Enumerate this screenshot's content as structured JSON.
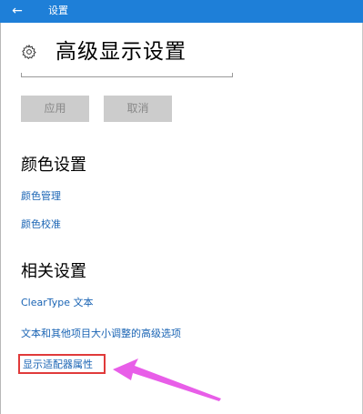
{
  "window": {
    "back_glyph": "←",
    "title": "设置",
    "accent_color": "#1e7fd8"
  },
  "page": {
    "icon": "gear-icon",
    "title": "高级显示设置"
  },
  "actions": {
    "apply_label": "应用",
    "cancel_label": "取消"
  },
  "color_section": {
    "heading": "颜色设置",
    "links": [
      "颜色管理",
      "颜色校准"
    ]
  },
  "related_section": {
    "heading": "相关设置",
    "links": [
      "ClearType 文本",
      "文本和其他项目大小调整的高级选项",
      "显示适配器属性"
    ]
  },
  "annotation": {
    "highlight_color": "#e03a3a",
    "arrow_color": "#e85ee8"
  }
}
